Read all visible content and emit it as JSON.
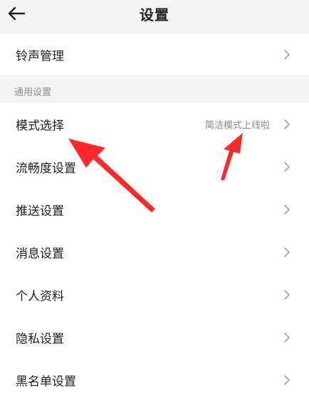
{
  "header": {
    "title": "设置",
    "back_icon": "arrow-left-icon"
  },
  "top_card": {
    "label": "铃声管理"
  },
  "section": {
    "label": "通用设置"
  },
  "items": [
    {
      "label": "模式选择",
      "value": "简洁模式上线啦"
    },
    {
      "label": "流畅度设置"
    },
    {
      "label": "推送设置"
    },
    {
      "label": "消息设置"
    },
    {
      "label": "个人资料"
    },
    {
      "label": "隐私设置"
    },
    {
      "label": "黑名单设置"
    }
  ],
  "colors": {
    "background": "#f3f3f3",
    "card": "#ffffff",
    "text": "#202020",
    "secondary_text": "#8a8a8a",
    "annotation_arrow": "#ff2a2a"
  }
}
